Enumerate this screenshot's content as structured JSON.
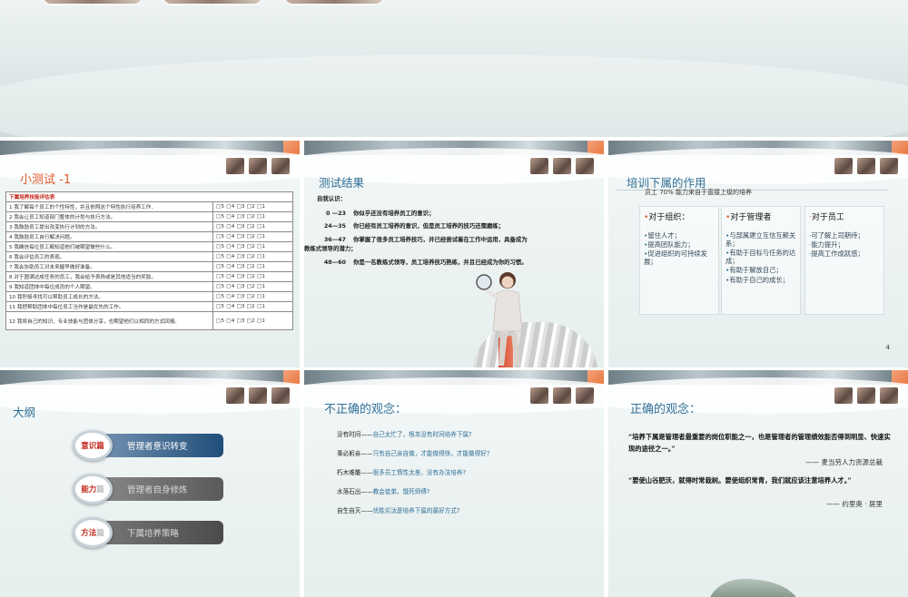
{
  "slide1": {
    "title": "小测试 -1",
    "table_header": "下属培养技能评估表",
    "score_options": "□5 □4 □3 □2 □1",
    "rows": [
      "1  我了解每个员工的个性特性，并且依照这个特性执行培养工作．",
      "2  我会让员工知道部门整体的计划与执行方法。",
      "3  我鼓励员工提出改变执行计划的方法。",
      "4  我鼓励员工自行解决问题。",
      "5  我确信每位员工都知道他们被期望做些什么。",
      "6  我会评估员工的表现。",
      "7  我会协助员工对未来握早做好准备。",
      "8  对于圆满达成任务的员工，我会给予表扬或是其他适当的奖励。",
      "9  我知道团体中每位成员的个人期望。",
      "10  我积极寻找可以帮助员工成长的方法。",
      "11  我把帮助团体中每位员工当作是最优先的工作。",
      "12  我将自己的知识、专业技能与团体分享，也期望他们以相同的方式回报。"
    ]
  },
  "slide2": {
    "title": "测试结果",
    "label": "自我认识：",
    "results": [
      {
        "range": "0 —23",
        "text": "你似乎还没有培养员工的意识；"
      },
      {
        "range": "24—35",
        "text": "你已经有员工培养的意识，但是员工培养的技巧还需磨练；"
      },
      {
        "range": "36—47",
        "text": "你掌握了很多员工培养技巧，并已经尝试着在工作中运用，具备成为"
      },
      {
        "range": "",
        "text": "教练式领导的潜力；"
      },
      {
        "range": "48—60",
        "text": "你是一名教练式领导，员工培养技巧熟练，并且已经成为你的习惯。"
      }
    ]
  },
  "slide3": {
    "title": "培训下属的作用",
    "subtitle": "员工 70% 能力来自于直接上级的培养",
    "columns": [
      {
        "head": "对于组织：",
        "items": [
          "留住人才；",
          "提高团队能力；",
          "促进组织的可持续发展；"
        ]
      },
      {
        "head": "对于管理者",
        "items": [
          "与部属建立互信互赖关系；",
          "有助于目标与任务的达成；",
          "有助于解放自己；",
          "有助于自己的成长；"
        ]
      },
      {
        "head": "对于员工",
        "items": [
          "可了解上司期待；",
          "能力提升；",
          "提高工作成就感；"
        ]
      }
    ],
    "page_number": "4"
  },
  "slide4": {
    "title": "大纲",
    "items": [
      {
        "badge_a": "意识",
        "badge_b": "篇",
        "label": "管理者意识转变"
      },
      {
        "badge_a": "能力",
        "badge_b": "篇",
        "label": "管理者自身修炼"
      },
      {
        "badge_a": "方法",
        "badge_b": "篇",
        "label": "下属培养策略"
      }
    ]
  },
  "slide5": {
    "title": "不正确的观念：",
    "rows": [
      {
        "k": "没有时间——",
        "v": "自己太忙了，根本没有时间培养下属?"
      },
      {
        "k": "事必躬亲——",
        "v": "只有自己亲自做，才能做得快，才能做得好?"
      },
      {
        "k": "朽木难雕——",
        "v": "很多员工惰性太差，没有办法培养?"
      },
      {
        "k": "水落石出——",
        "v": "教会徒弟，饿死师傅?"
      },
      {
        "k": "自生自灭——",
        "v": "优胜劣汰是培养下属的最好方式?"
      }
    ]
  },
  "slide6": {
    "title": "正确的观念：",
    "quote1": "“培养下属是管理者最重要的岗位职能之一，也是管理者的管理绩效能否得到明显、快速实现的途径之一。”",
    "author1": "—— 麦当劳人力资源总裁",
    "quote2": "“要使山谷肥沃，就得时常栽树。要使组织常青，我们就应该注意培养人才。”",
    "author2": "—— 约里奥 · 居里"
  },
  "colors": {
    "accent_blue": "#2f6f96",
    "accent_orange": "#e4582c",
    "outline_bar_1": "#1f4e79",
    "outline_bar_2": "#5a5a5a",
    "outline_bar_3": "#4b4b4b"
  }
}
